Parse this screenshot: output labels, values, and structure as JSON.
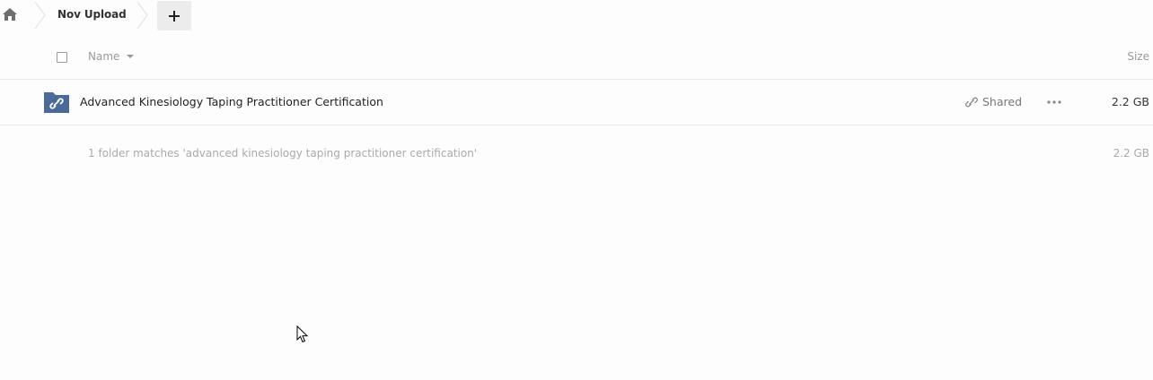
{
  "breadcrumb": {
    "home_icon": "home-icon",
    "folder_label": "Nov Upload",
    "new_button_icon": "plus-icon"
  },
  "table": {
    "header": {
      "name_label": "Name",
      "size_label": "Size"
    },
    "rows": [
      {
        "icon": "shared-folder-icon",
        "name": "Advanced Kinesiology Taping Practitioner Certification",
        "shared_label": "Shared",
        "size": "2.2 GB"
      }
    ],
    "summary": {
      "text": "1 folder matches 'advanced kinesiology taping practitioner certification'",
      "size": "2.2 GB"
    }
  },
  "colors": {
    "folder": "#4a6a9a",
    "new_button_bg": "#ececec",
    "muted_text": "#999999"
  }
}
